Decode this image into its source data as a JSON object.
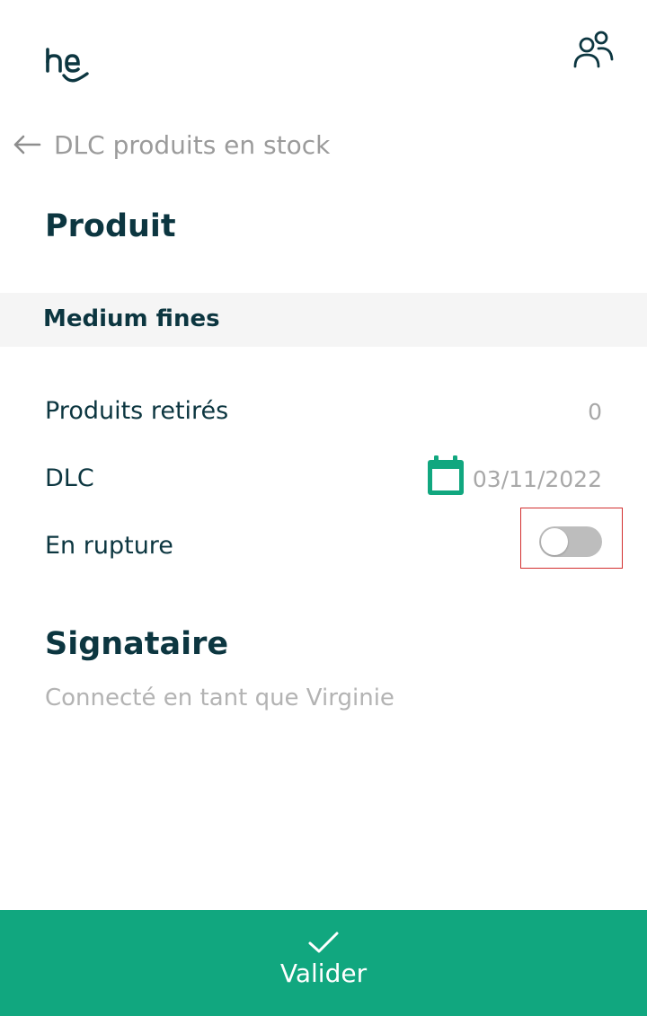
{
  "header": {
    "logo_icon": "he-logo",
    "users_icon": "users-icon",
    "back_icon": "arrow-left-icon",
    "title": "DLC produits en stock"
  },
  "product_section": {
    "title": "Produit",
    "product_name": "Medium fines"
  },
  "fields": {
    "removed_label": "Produits retirés",
    "removed_value": "0",
    "dlc_label": "DLC",
    "dlc_icon": "calendar-icon",
    "dlc_value": "03/11/2022",
    "rupture_label": "En rupture",
    "rupture_on": false
  },
  "signatory": {
    "title": "Signataire",
    "connected_text": "Connecté en tant que Virginie"
  },
  "footer": {
    "check_icon": "check-icon",
    "validate_label": "Valider"
  },
  "colors": {
    "brand_dark": "#0c3640",
    "accent_green": "#11a77f",
    "muted_text": "#a8a8a8",
    "toggle_off": "#bdbdbd",
    "highlight_border": "#d32f2f"
  }
}
